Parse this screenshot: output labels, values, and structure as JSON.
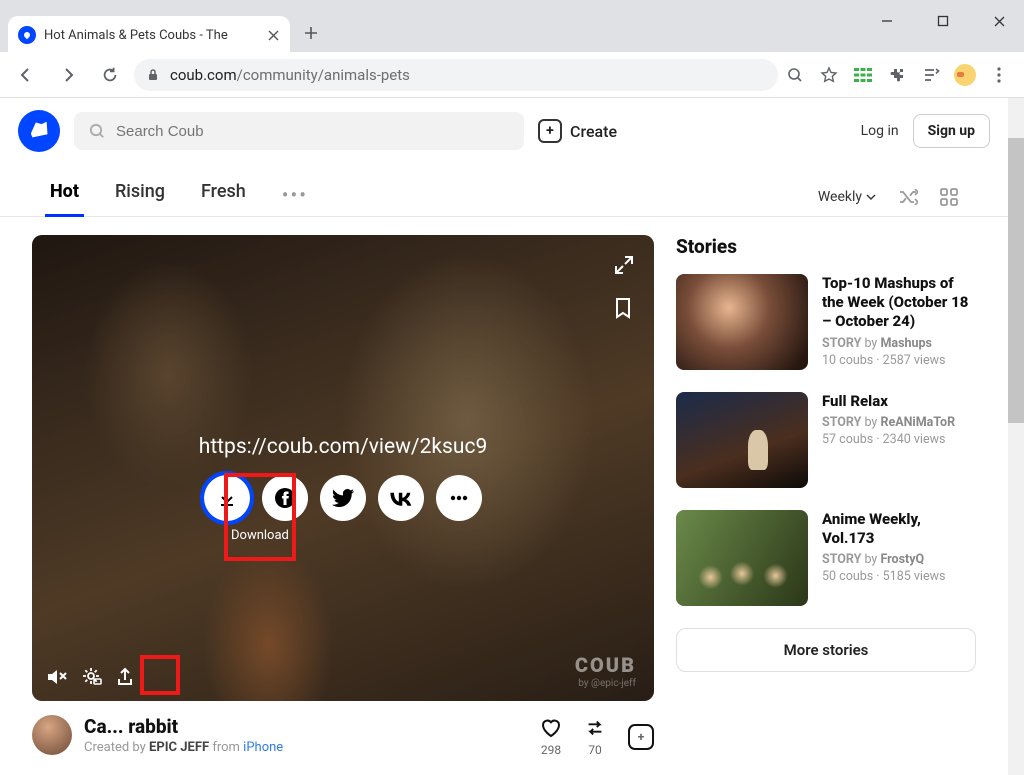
{
  "browser": {
    "tab_title": "Hot Animals & Pets Coubs - The",
    "url_host": "coub.com",
    "url_path": "/community/animals-pets"
  },
  "header": {
    "search_placeholder": "Search Coub",
    "create": "Create",
    "login": "Log in",
    "signup": "Sign up"
  },
  "nav": {
    "tabs": [
      "Hot",
      "Rising",
      "Fresh"
    ],
    "active": "Hot",
    "period": "Weekly"
  },
  "player": {
    "share_url": "https://coub.com/view/2ksuc9",
    "download_label": "Download",
    "watermark": "COUB",
    "watermark_sub": "by @epic-jeff"
  },
  "video": {
    "title": "Ca... rabbit",
    "created_by_prefix": "Created by ",
    "author": "EPIC JEFF",
    "from": " from ",
    "source": "iPhone",
    "likes": "298",
    "recoubs": "70"
  },
  "stories": {
    "heading": "Stories",
    "items": [
      {
        "title": "Top-10 Mashups of the Week (October 18 – October 24)",
        "author": "Mashups",
        "coubs": "10 coubs",
        "views": "2587 views"
      },
      {
        "title": "Full Relax",
        "author": "ReANiMaToR",
        "coubs": "57 coubs",
        "views": "2340 views"
      },
      {
        "title": "Anime Weekly, Vol.173",
        "author": "FrostyQ",
        "coubs": "50 coubs",
        "views": "5185 views"
      }
    ],
    "story_by_label": "STORY",
    "by": "by",
    "more": "More stories"
  }
}
